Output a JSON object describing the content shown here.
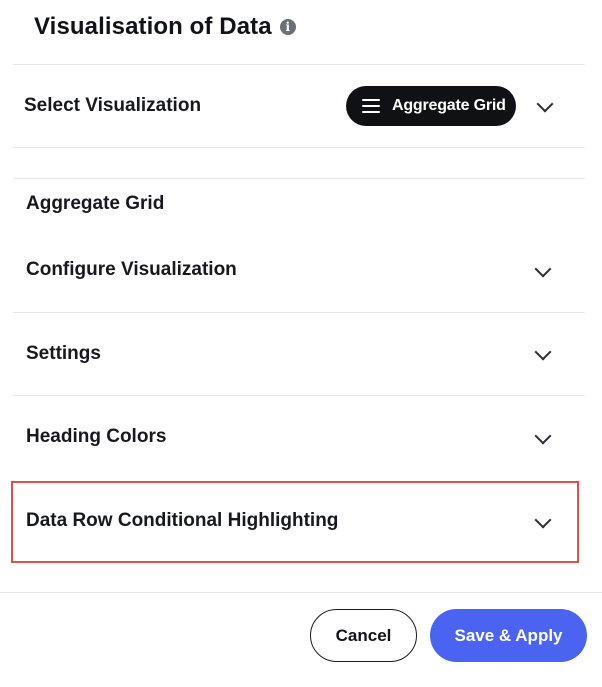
{
  "header": {
    "title": "Visualisation of Data",
    "info_icon": "info-icon"
  },
  "select_visualization": {
    "label": "Select Visualization",
    "selected": "Aggregate Grid",
    "selected_icon": "hamburger-menu-icon"
  },
  "current_visualization": {
    "label": "Aggregate Grid"
  },
  "sections": [
    {
      "label": "Configure Visualization"
    },
    {
      "label": "Settings"
    },
    {
      "label": "Heading Colors"
    },
    {
      "label": "Data Row Conditional Highlighting",
      "highlighted": true
    }
  ],
  "footer": {
    "cancel_label": "Cancel",
    "save_label": "Save & Apply"
  },
  "colors": {
    "primary": "#4a63f0",
    "pill_bg": "#0f1115",
    "highlight_border": "#e0504a"
  }
}
